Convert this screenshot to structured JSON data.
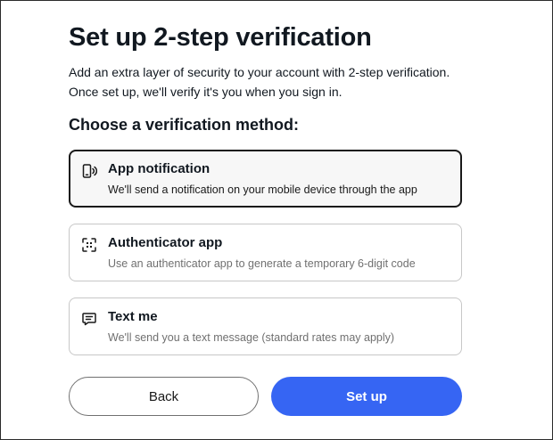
{
  "page": {
    "title": "Set up 2-step verification",
    "description_line1": "Add an extra layer of security to your account with 2-step verification.",
    "description_line2": "Once set up, we'll verify it's you when you sign in.",
    "subheading": "Choose a verification method:"
  },
  "options": [
    {
      "icon": "mobile-notification-icon",
      "title": "App notification",
      "description": "We'll send a notification on your mobile device through the app",
      "selected": true
    },
    {
      "icon": "qr-scan-icon",
      "title": "Authenticator app",
      "description": "Use an authenticator app to generate a temporary 6-digit code",
      "selected": false
    },
    {
      "icon": "chat-message-icon",
      "title": "Text me",
      "description": "We'll send you a text message (standard rates may apply)",
      "selected": false
    }
  ],
  "buttons": {
    "back_label": "Back",
    "setup_label": "Set up"
  },
  "colors": {
    "primary": "#3665f3",
    "text": "#111820",
    "muted": "#707070",
    "border": "#c7c7c7"
  }
}
